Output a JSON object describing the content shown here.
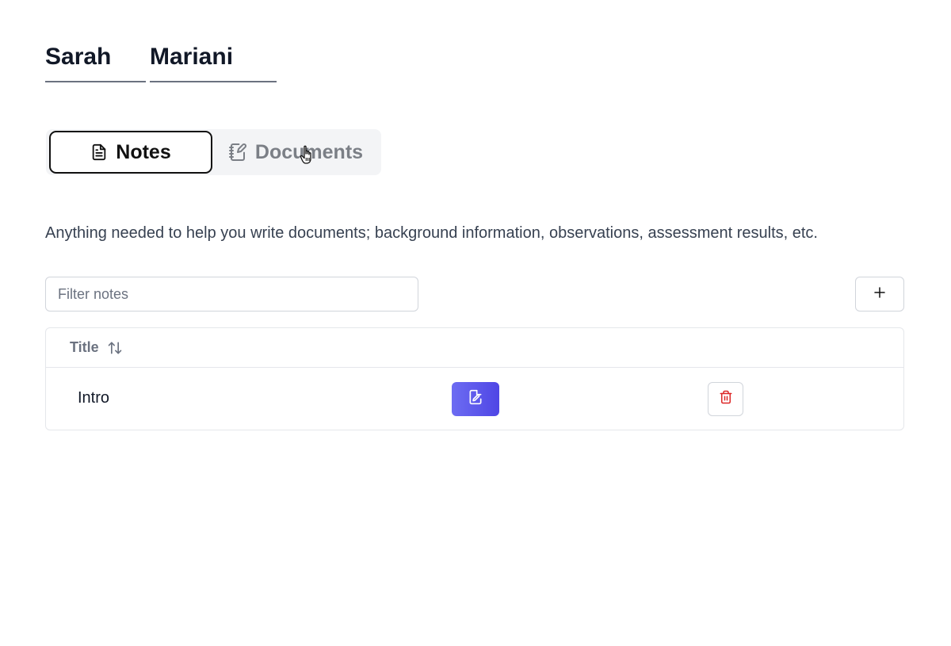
{
  "person": {
    "first_name": "Sarah",
    "last_name": "Mariani"
  },
  "tabs": [
    {
      "label": "Notes",
      "icon": "file-text-icon",
      "active": true
    },
    {
      "label": "Documents",
      "icon": "notebook-pen-icon",
      "active": false
    }
  ],
  "description": "Anything needed to help you write documents; background information, observations, assessment results, etc.",
  "filter": {
    "placeholder": "Filter notes",
    "value": ""
  },
  "add_button": {
    "icon": "plus-icon"
  },
  "table": {
    "columns": [
      {
        "label": "Title",
        "sort_icon": "sort-arrows-icon"
      }
    ],
    "rows": [
      {
        "title": "Intro",
        "edit_icon": "edit-icon",
        "delete_icon": "trash-icon"
      }
    ]
  },
  "colors": {
    "accent": "#5b57ee",
    "danger": "#dc2626",
    "text": "#111827",
    "muted": "#6b7280"
  }
}
